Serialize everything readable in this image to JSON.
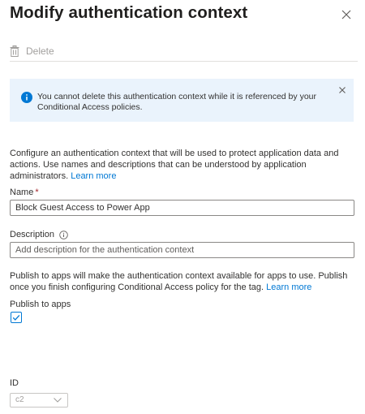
{
  "panel": {
    "title": "Modify authentication context"
  },
  "toolbar": {
    "delete_label": "Delete"
  },
  "info_bar": {
    "message": "You cannot delete this authentication context while it is referenced by your Conditional Access policies."
  },
  "description": {
    "text": "Configure an authentication context that will be used to protect application data and actions. Use names and descriptions that can be understood by application administrators.",
    "link_text": "Learn more"
  },
  "name_field": {
    "label": "Name",
    "required_marker": "*",
    "value": "Block Guest Access to Power App"
  },
  "description_field": {
    "label": "Description",
    "placeholder": "Add description for the authentication context"
  },
  "publish": {
    "text": "Publish to apps will make the authentication context available for apps to use. Publish once you finish configuring Conditional Access policy for the tag.",
    "link_text": "Learn more",
    "checkbox_label": "Publish to apps",
    "checked": true
  },
  "id_field": {
    "label": "ID",
    "value": "c2"
  },
  "colors": {
    "accent": "#0078d4",
    "info_background": "#eaf3fc",
    "required": "#a4262c",
    "disabled_text": "#a19f9d"
  },
  "icons": [
    "close-icon",
    "trash-icon",
    "info-icon",
    "dismiss-icon",
    "info-circle-icon",
    "checkmark-icon",
    "chevron-down-icon"
  ]
}
